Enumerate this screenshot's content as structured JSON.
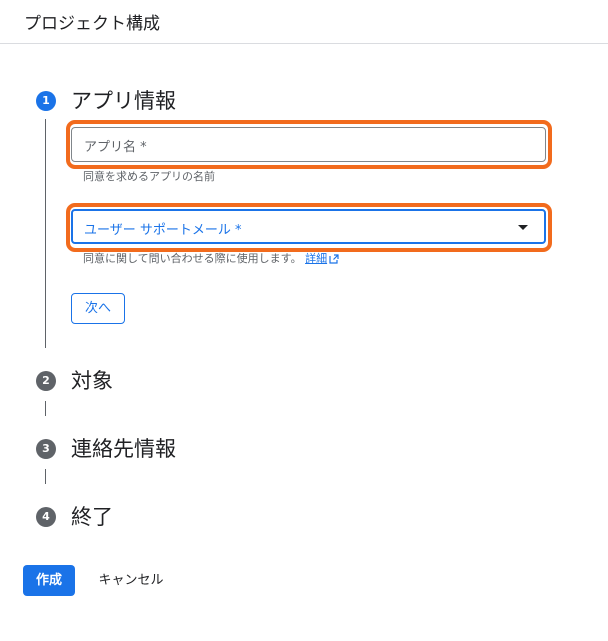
{
  "header": {
    "title": "プロジェクト構成"
  },
  "steps": [
    {
      "number": "1",
      "title": "アプリ情報"
    },
    {
      "number": "2",
      "title": "対象"
    },
    {
      "number": "3",
      "title": "連絡先情報"
    },
    {
      "number": "4",
      "title": "終了"
    }
  ],
  "app_info": {
    "app_name_placeholder": "アプリ名 *",
    "app_name_helper": "同意を求めるアプリの名前",
    "support_email_label": "ユーザー サポートメール *",
    "support_email_helper": "同意に関して問い合わせる際に使用します。",
    "support_email_link": "詳細",
    "next_label": "次へ"
  },
  "actions": {
    "create_label": "作成",
    "cancel_label": "キャンセル"
  },
  "colors": {
    "accent": "#1a73e8",
    "highlight": "#f26b1d",
    "step_inactive": "#5f6368"
  },
  "icons": {
    "dropdown": "arrow-drop-down-icon",
    "external_link": "open-in-new-icon"
  }
}
